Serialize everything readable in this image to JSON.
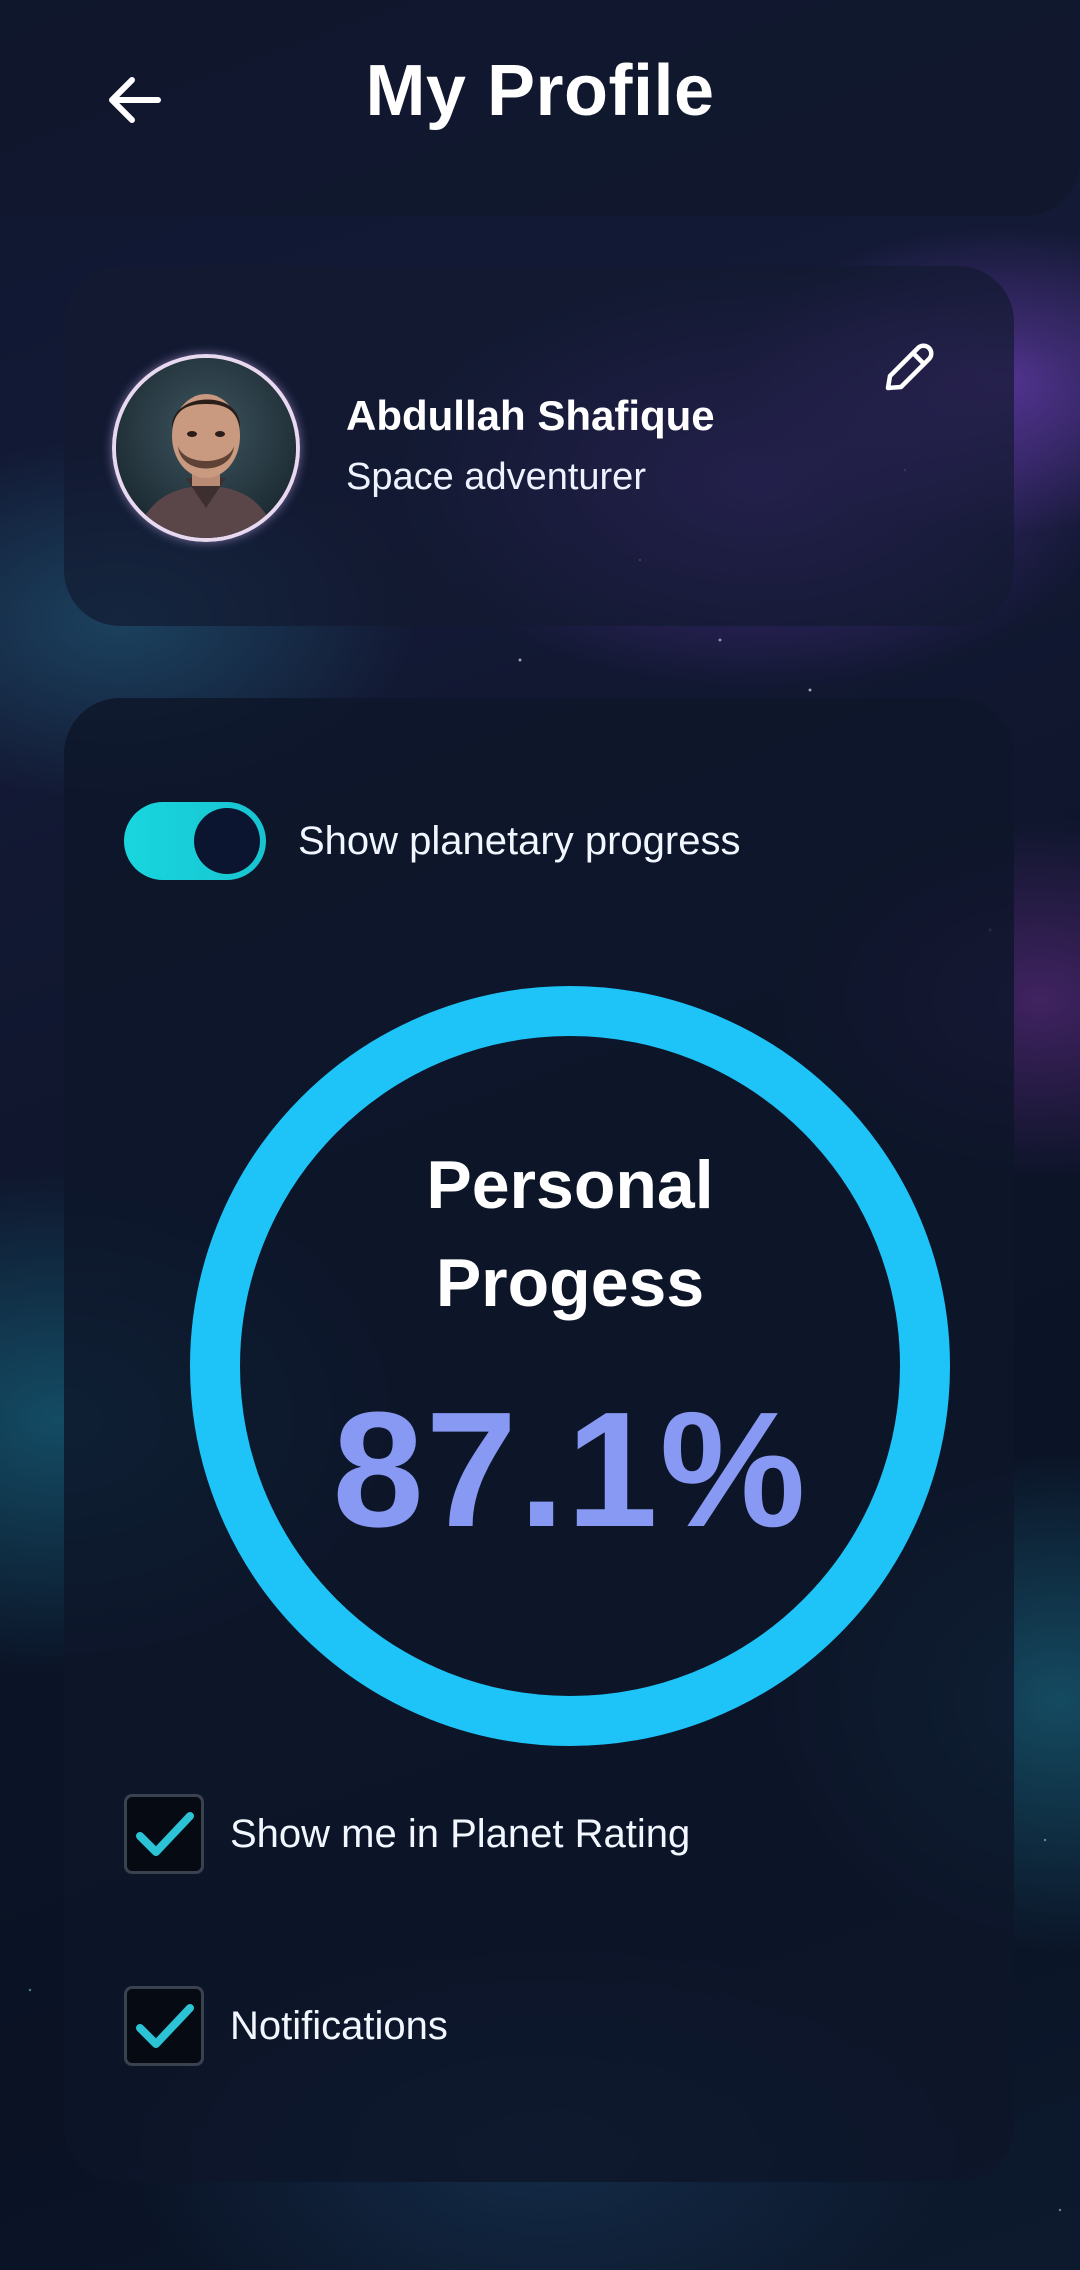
{
  "header": {
    "title": "My Profile",
    "back_icon": "arrow-left-icon"
  },
  "profile": {
    "name": "Abdullah Shafique",
    "subtitle": "Space adventurer",
    "avatar_icon": "avatar",
    "edit_icon": "pencil-icon"
  },
  "settings": {
    "toggle": {
      "label": "Show planetary progress",
      "on": true
    },
    "progress": {
      "title": "Personal Progess",
      "value_text": "87.1%",
      "value": 87.1,
      "ring_color": "#1ec3f7",
      "value_color": "#8899f3"
    },
    "checkboxes": [
      {
        "label": "Show me in Planet Rating",
        "checked": true
      },
      {
        "label": "Notifications",
        "checked": true
      }
    ]
  },
  "colors": {
    "accent": "#1ec3f7",
    "toggle_on": "#19d6de",
    "check": "#2cc3d6"
  }
}
